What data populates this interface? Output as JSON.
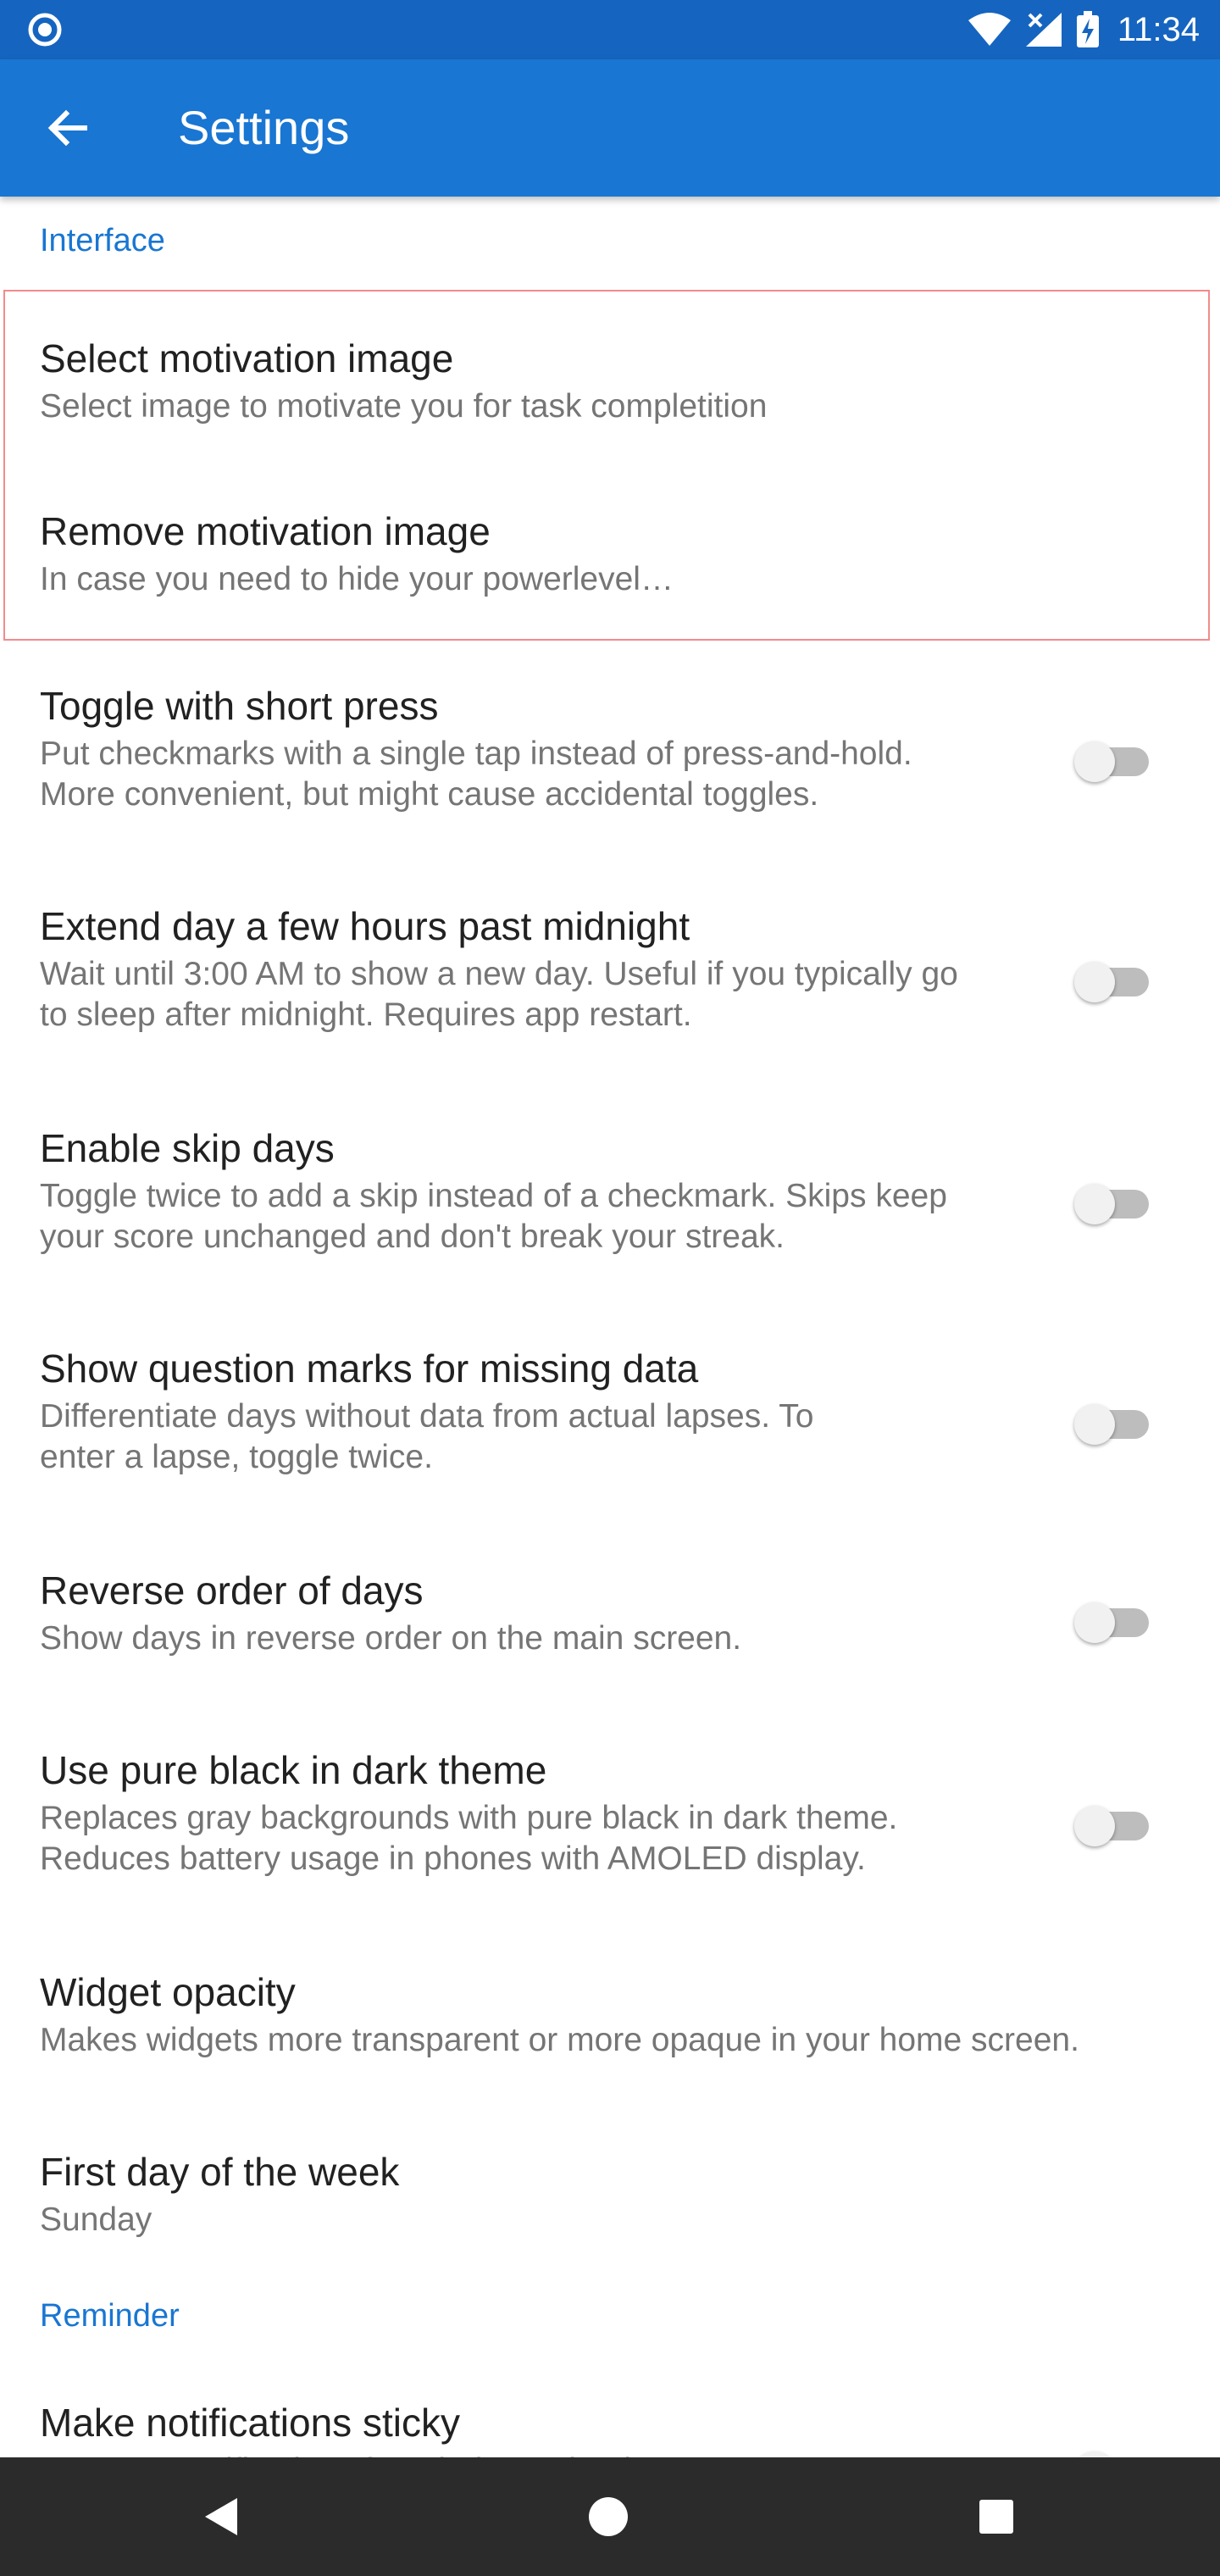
{
  "status_bar": {
    "time": "11:34",
    "icons": [
      "notification-dot-icon",
      "wifi-icon",
      "signal-icon",
      "battery-charging-icon"
    ]
  },
  "app_bar": {
    "title": "Settings",
    "back_icon": "arrow-back-icon"
  },
  "sections": {
    "interface": {
      "label": "Interface",
      "items": [
        {
          "title": "Select motivation image",
          "summary": "Select image to motivate you for task completition"
        },
        {
          "title": "Remove motivation image",
          "summary": "In case you need to hide your powerlevel…"
        },
        {
          "title": "Toggle with short press",
          "summary": "Put checkmarks with a single tap instead of press-and-hold.\nMore convenient, but might cause accidental toggles.",
          "switch_on": false
        },
        {
          "title": "Extend day a few hours past midnight",
          "summary": "Wait until 3:00 AM to show a new day. Useful if you typically go\nto sleep after midnight. Requires app restart.",
          "switch_on": false
        },
        {
          "title": "Enable skip days",
          "summary": "Toggle twice to add a skip instead of a checkmark. Skips keep\nyour score unchanged and don't break your streak.",
          "switch_on": false
        },
        {
          "title": "Show question marks for missing data",
          "summary": "Differentiate days without data from actual lapses. To\nenter a lapse, toggle twice.",
          "switch_on": false
        },
        {
          "title": "Reverse order of days",
          "summary": "Show days in reverse order on the main screen.",
          "switch_on": false
        },
        {
          "title": "Use pure black in dark theme",
          "summary": "Replaces gray backgrounds with pure black in dark theme.\nReduces battery usage in phones with AMOLED display.",
          "switch_on": false
        },
        {
          "title": "Widget opacity",
          "summary": "Makes widgets more transparent or more opaque in your home screen."
        },
        {
          "title": "First day of the week",
          "summary": "Sunday"
        }
      ]
    },
    "reminder": {
      "label": "Reminder",
      "items": [
        {
          "title": "Make notifications sticky",
          "summary": "Prevents notifications from being swiped away.",
          "switch_on": false
        }
      ]
    }
  },
  "nav_bar": {
    "icons": [
      "back-triangle-icon",
      "home-circle-icon",
      "recents-square-icon"
    ]
  },
  "colors": {
    "status_bar": "#1565c0",
    "app_bar": "#1976d2",
    "category_text": "#1976d2",
    "highlight_border": "#f28b8b",
    "nav_bar": "#2b2b2b"
  }
}
